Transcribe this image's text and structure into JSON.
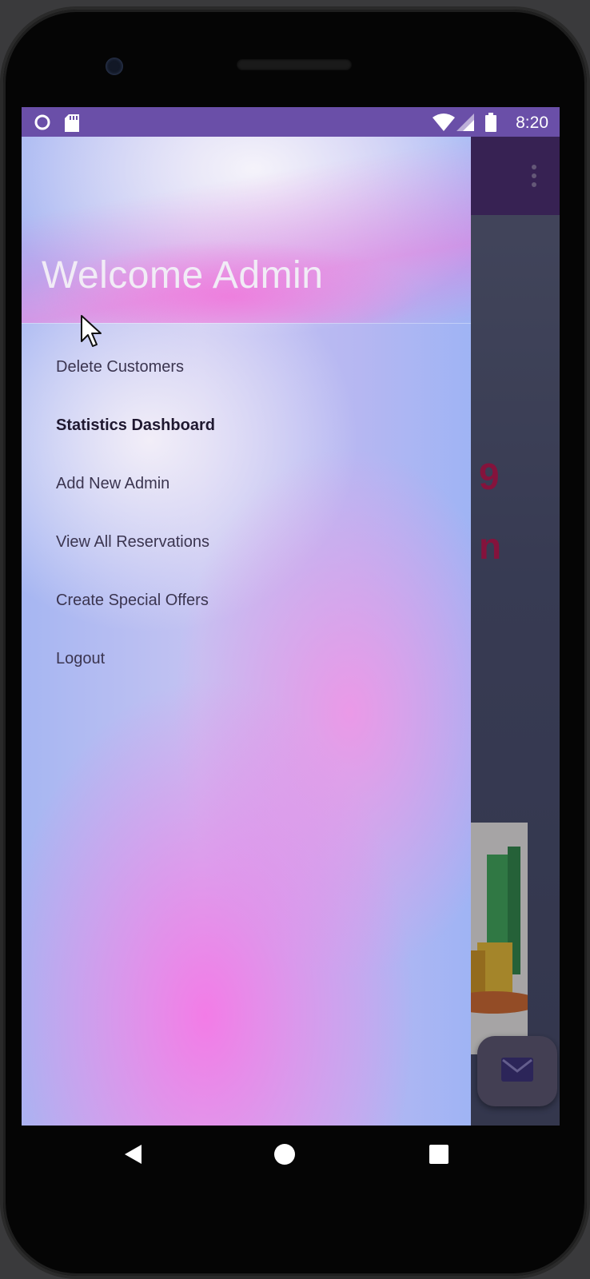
{
  "status_bar": {
    "time": "8:20",
    "left_icons": [
      "circle-notification-icon",
      "sd-card-icon"
    ],
    "right_icons": [
      "wifi-icon",
      "signal-icon",
      "battery-icon"
    ],
    "color": "#6a4fa8"
  },
  "background_app": {
    "app_bar_color": "#4b2a70",
    "partial_text_1": "9",
    "partial_text_2": "n",
    "text_color": "#c0134e",
    "fab_icon": "mail-icon"
  },
  "drawer": {
    "header_title": "Welcome Admin",
    "items": [
      {
        "label": "Delete Customers",
        "active": false
      },
      {
        "label": "Statistics Dashboard",
        "active": true
      },
      {
        "label": "Add New Admin",
        "active": false
      },
      {
        "label": "View All Reservations",
        "active": false
      },
      {
        "label": "Create Special Offers",
        "active": false
      },
      {
        "label": "Logout",
        "active": false
      }
    ]
  },
  "nav_bar": {
    "buttons": [
      "back-icon",
      "home-icon",
      "recents-icon"
    ]
  }
}
